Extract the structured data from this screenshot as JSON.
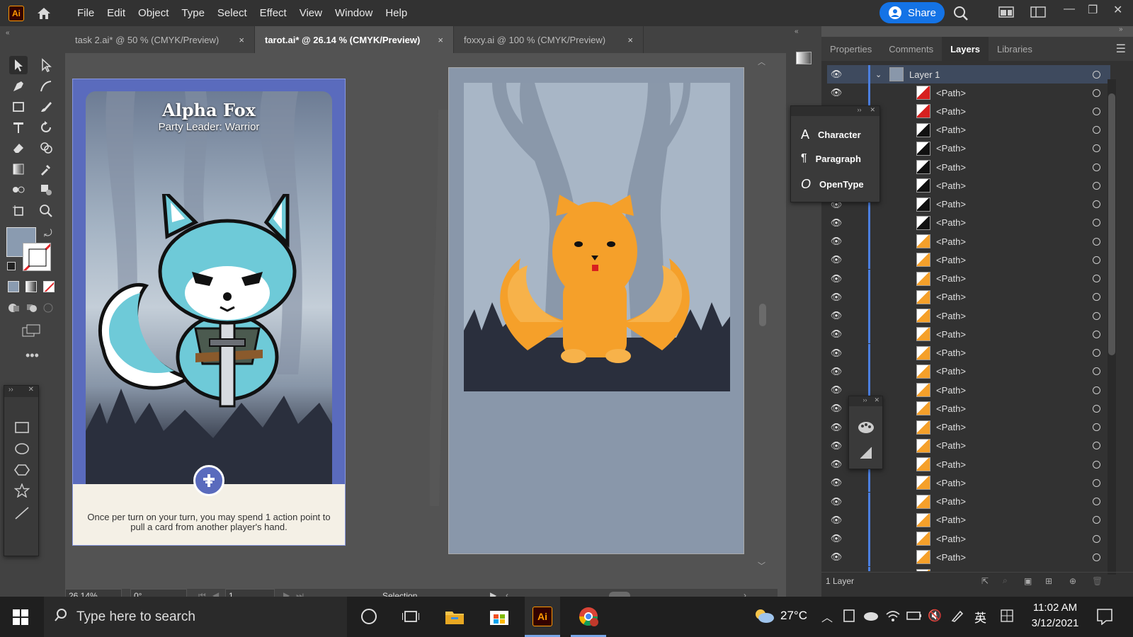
{
  "app": {
    "logo": "Ai",
    "share_label": "Share"
  },
  "menu": [
    "File",
    "Edit",
    "Object",
    "Type",
    "Select",
    "Effect",
    "View",
    "Window",
    "Help"
  ],
  "tabs": [
    {
      "label": "task 2.ai* @ 50 % (CMYK/Preview)",
      "active": false
    },
    {
      "label": "tarot.ai* @ 26.14 % (CMYK/Preview)",
      "active": true
    },
    {
      "label": "foxxy.ai @ 100 % (CMYK/Preview)",
      "active": false
    }
  ],
  "tab_close": "×",
  "card": {
    "title": "Alpha Fox",
    "subtitle": "Party Leader: Warrior",
    "ability_text": "Once per turn on your turn, you may spend 1 action point to pull a card from another player's hand."
  },
  "colors": {
    "accent_blue": "#1473e6",
    "card_border": "#5a6bbd",
    "fox_orange": "#f5a02a",
    "fox_teal": "#6ecad8"
  },
  "status": {
    "zoom": "26.14%",
    "rotation": "0°",
    "artboard": "1",
    "tool": "Selection"
  },
  "panel": {
    "tabs": [
      "Properties",
      "Comments",
      "Layers",
      "Libraries"
    ],
    "active_tab": "Layers",
    "layer_name": "Layer 1",
    "path_label": "<Path>",
    "path_count": 27,
    "footer": "1 Layer"
  },
  "type_panel": [
    "Character",
    "Paragraph",
    "OpenType"
  ],
  "taskbar": {
    "search_placeholder": "Type here to search",
    "weather": "27°C",
    "ime": "英",
    "time": "11:02 AM",
    "date": "3/12/2021"
  }
}
